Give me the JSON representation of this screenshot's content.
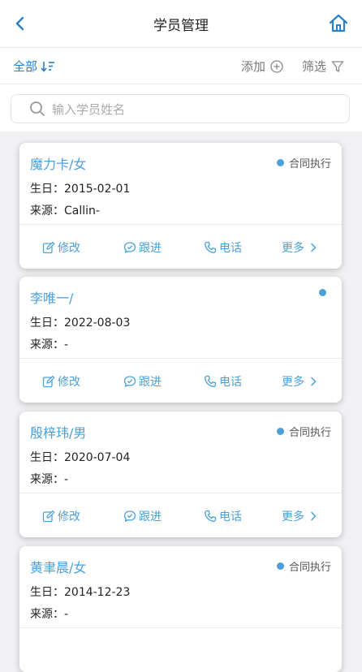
{
  "header": {
    "title": "学员管理"
  },
  "toolbar": {
    "all_label": "全部",
    "add_label": "添加",
    "filter_label": "筛选"
  },
  "search": {
    "placeholder": "输入学员姓名"
  },
  "colors": {
    "accent": "#4aa0d8",
    "primary": "#2a7fc9"
  },
  "labels": {
    "birthday": "生日：",
    "source": "来源："
  },
  "actions": {
    "edit": "修改",
    "follow": "跟进",
    "phone": "电话",
    "more": "更多"
  },
  "students": [
    {
      "name": "魔力卡/女",
      "status": "合同执行",
      "birthday": "2015-02-01",
      "source": "Callin-"
    },
    {
      "name": "李唯一/",
      "status": "",
      "birthday": "2022-08-03",
      "source": "-"
    },
    {
      "name": "殷梓玮/男",
      "status": "合同执行",
      "birthday": "2020-07-04",
      "source": "-"
    },
    {
      "name": "黄聿晨/女",
      "status": "合同执行",
      "birthday": "2014-12-23",
      "source": "-"
    }
  ]
}
